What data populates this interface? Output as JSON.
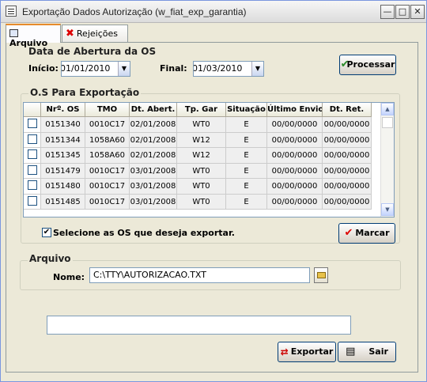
{
  "window": {
    "title": "Exportação Dados Autorização (w_fiat_exp_garantia)"
  },
  "tabs": [
    {
      "label": "Arquivo"
    },
    {
      "label": "Rejeições"
    }
  ],
  "period": {
    "group_label": "Data de Abertura da OS",
    "start_label": "Início:",
    "start_value": "01/01/2010",
    "end_label": "Final:",
    "end_value": "01/03/2010",
    "process_button": "Processar"
  },
  "os_group": {
    "label": "O.S  Para  Exportação",
    "columns": [
      "",
      "Nrº. OS",
      "TMO",
      "Dt. Abert.",
      "Tp. Gar",
      "Situação",
      "Último Envio",
      "Dt. Ret."
    ],
    "rows": [
      {
        "os": "0151340",
        "tmo": "0010C17",
        "dt_abert": "02/01/2008",
        "tp_gar": "WT0",
        "situacao": "E",
        "ultimo_envio": "00/00/0000",
        "dt_ret": "00/00/0000"
      },
      {
        "os": "0151344",
        "tmo": "1058A60",
        "dt_abert": "02/01/2008",
        "tp_gar": "W12",
        "situacao": "E",
        "ultimo_envio": "00/00/0000",
        "dt_ret": "00/00/0000"
      },
      {
        "os": "0151345",
        "tmo": "1058A60",
        "dt_abert": "02/01/2008",
        "tp_gar": "W12",
        "situacao": "E",
        "ultimo_envio": "00/00/0000",
        "dt_ret": "00/00/0000"
      },
      {
        "os": "0151479",
        "tmo": "0010C17",
        "dt_abert": "03/01/2008",
        "tp_gar": "WT0",
        "situacao": "E",
        "ultimo_envio": "00/00/0000",
        "dt_ret": "00/00/0000"
      },
      {
        "os": "0151480",
        "tmo": "0010C17",
        "dt_abert": "03/01/2008",
        "tp_gar": "WT0",
        "situacao": "E",
        "ultimo_envio": "00/00/0000",
        "dt_ret": "00/00/0000"
      },
      {
        "os": "0151485",
        "tmo": "0010C17",
        "dt_abert": "03/01/2008",
        "tp_gar": "WT0",
        "situacao": "E",
        "ultimo_envio": "00/00/0000",
        "dt_ret": "00/00/0000"
      }
    ],
    "select_label": "Selecione as OS que deseja exportar.",
    "mark_button": "Marcar"
  },
  "file_group": {
    "label": "Arquivo",
    "name_label": "Nome:",
    "name_value": "C:\\TTY\\AUTORIZACAO.TXT"
  },
  "status_text": "",
  "actions": {
    "export_button": "Exportar",
    "exit_button": "Sair"
  }
}
